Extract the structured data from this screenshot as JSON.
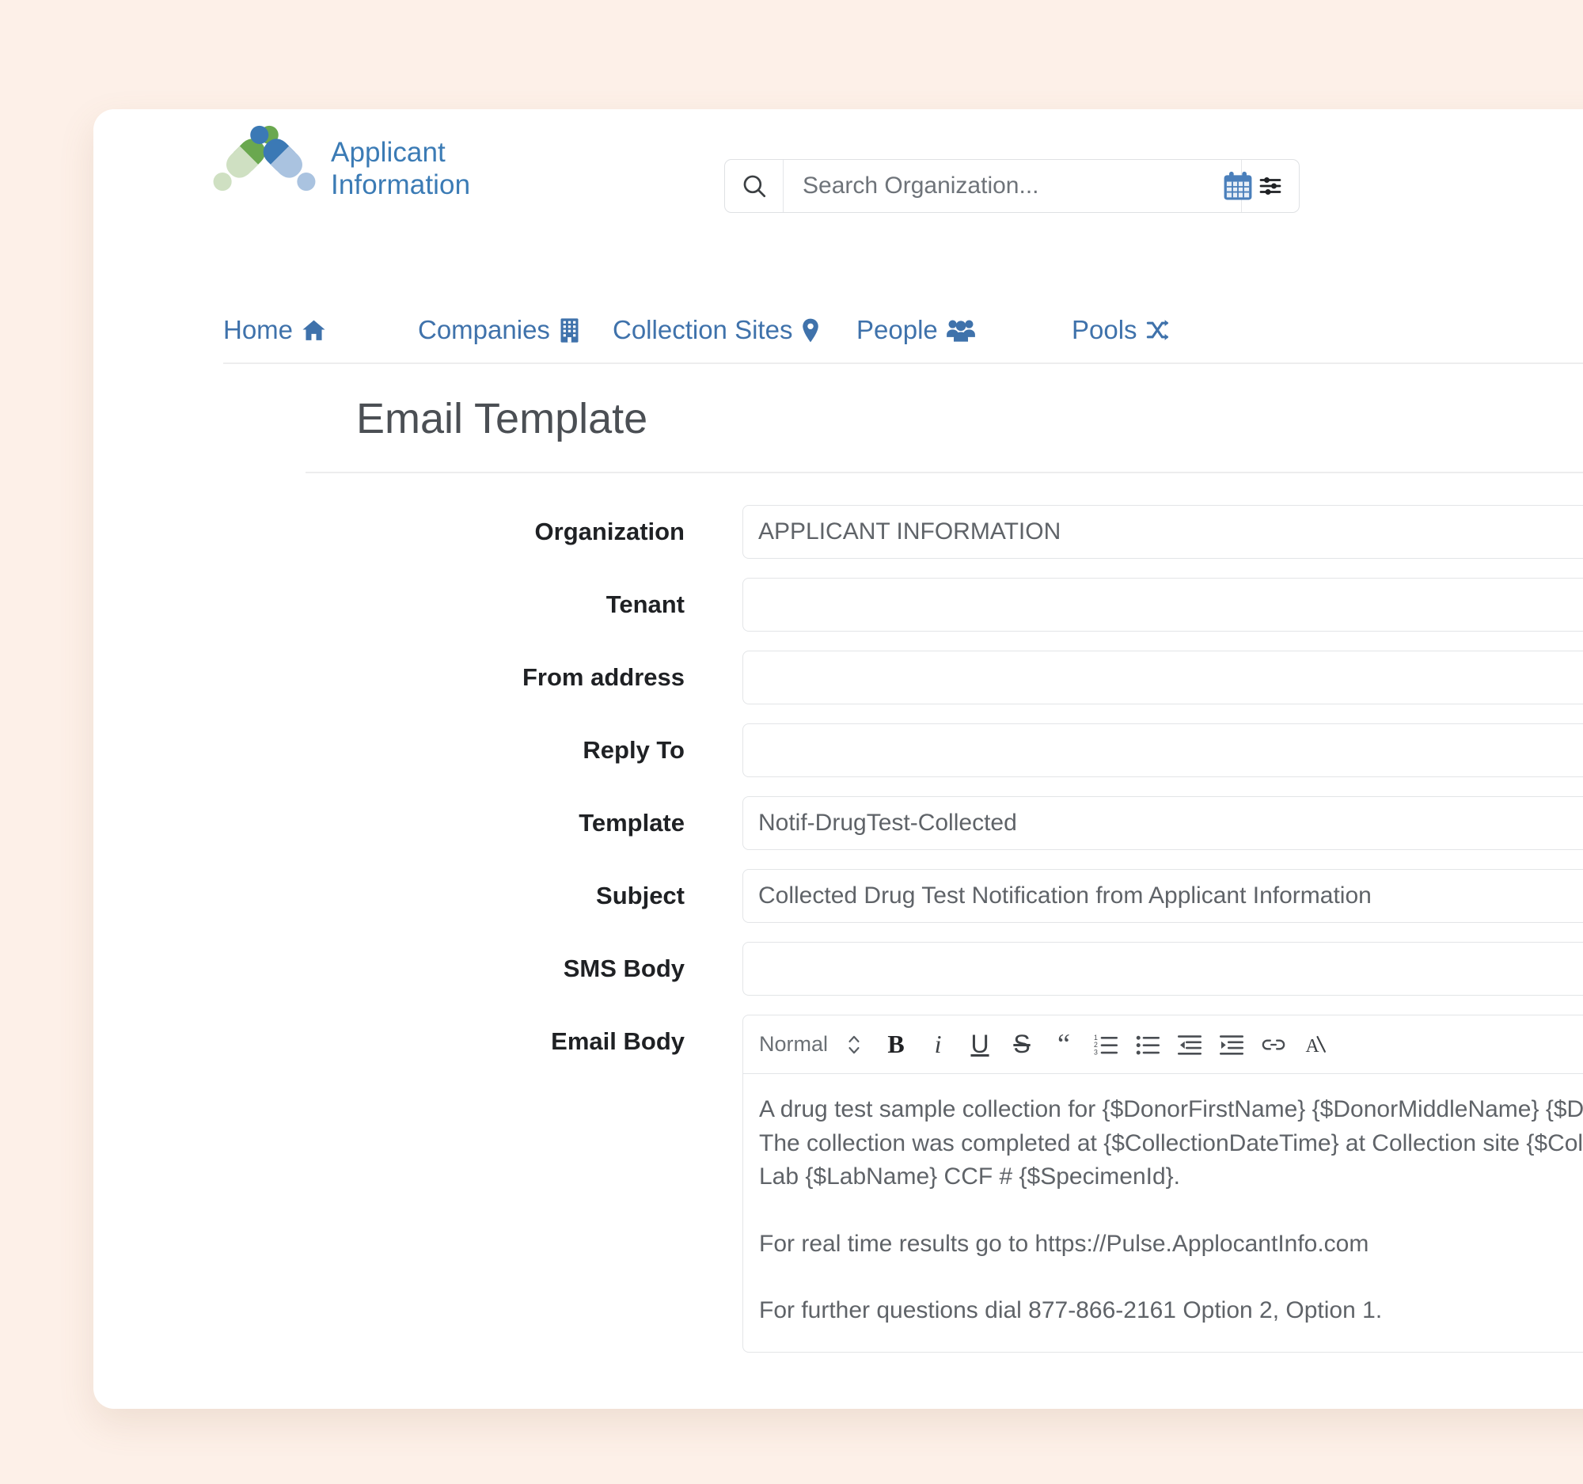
{
  "brand": {
    "line1": "Applicant",
    "line2": "Information",
    "logo_icon": "applicant-information-logo",
    "accent_color": "#3b7bb5",
    "logo_green": "#6aa84f",
    "logo_blue": "#3b79b5"
  },
  "header": {
    "search": {
      "placeholder": "Search Organization...",
      "value": "",
      "search_icon": "search-icon",
      "filter_icon": "sliders-filter-icon"
    },
    "calendar_icon": "calendar-icon"
  },
  "nav": {
    "items": [
      {
        "label": "Home",
        "icon": "home-icon"
      },
      {
        "label": "Companies",
        "icon": "building-icon"
      },
      {
        "label": "Collection Sites",
        "icon": "map-pin-icon"
      },
      {
        "label": "People",
        "icon": "people-group-icon"
      },
      {
        "label": "Pools",
        "icon": "shuffle-icon"
      }
    ]
  },
  "page": {
    "title": "Email Template"
  },
  "form": {
    "fields": [
      {
        "label": "Organization",
        "value": "APPLICANT INFORMATION",
        "placeholder": ""
      },
      {
        "label": "Tenant",
        "value": "",
        "placeholder": ""
      },
      {
        "label": "From address",
        "value": "",
        "placeholder": ""
      },
      {
        "label": "Reply To",
        "value": "",
        "placeholder": ""
      },
      {
        "label": "Template",
        "value": "Notif-DrugTest-Collected",
        "placeholder": ""
      },
      {
        "label": "Subject",
        "value": "Collected Drug Test Notification from Applicant Information",
        "placeholder": ""
      },
      {
        "label": "SMS Body",
        "value": "",
        "placeholder": ""
      }
    ],
    "email_body": {
      "label": "Email Body",
      "toolbar": {
        "format_label": "Normal",
        "buttons": [
          {
            "name": "format-dropdown-chevron",
            "glyph": "⇕"
          },
          {
            "name": "bold-button",
            "glyph": "B"
          },
          {
            "name": "italic-button",
            "glyph": "i"
          },
          {
            "name": "underline-button",
            "glyph": "U"
          },
          {
            "name": "strikethrough-button",
            "glyph": "S"
          },
          {
            "name": "blockquote-button",
            "glyph": "“"
          },
          {
            "name": "ordered-list-button",
            "glyph": "ordered-list-icon"
          },
          {
            "name": "bullet-list-button",
            "glyph": "bullet-list-icon"
          },
          {
            "name": "outdent-button",
            "glyph": "outdent-icon"
          },
          {
            "name": "indent-button",
            "glyph": "indent-icon"
          },
          {
            "name": "link-button",
            "glyph": "link-icon"
          },
          {
            "name": "clear-format-button",
            "glyph": "clear-format-icon"
          }
        ]
      },
      "paragraphs": [
        "A drug test sample collection for {$DonorFirstName} {$DonorMiddleName} {$DonorLastName}. The collection was completed at {$CollectionDateTime} at Collection site {$CollectionSiteName} Lab {$LabName} CCF # {$SpecimenId}.",
        "For real time results go to https://Pulse.ApplocantInfo.com",
        "For further questions dial 877-866-2161 Option 2, Option 1."
      ]
    }
  },
  "colors": {
    "page_background": "#fdf0e8",
    "card_background": "#ffffff",
    "nav_link": "#3f72ab",
    "label_text": "#1f2124",
    "field_text": "#5f6368",
    "title_text": "#4b4f54",
    "border": "#e3e5e7"
  }
}
